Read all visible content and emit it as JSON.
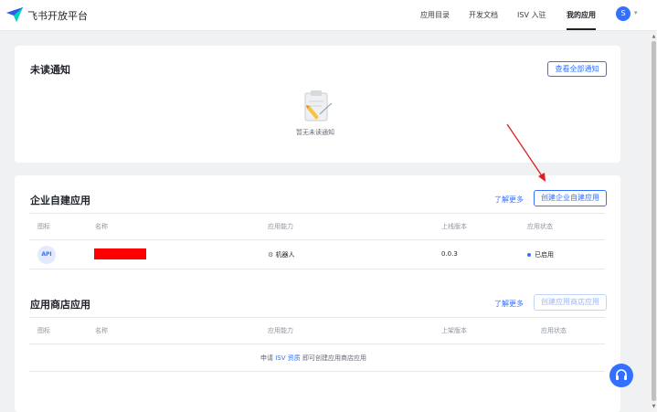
{
  "header": {
    "brand": "飞书开放平台",
    "nav": [
      "应用目录",
      "开发文档",
      "ISV 入驻",
      "我的应用"
    ],
    "active_nav": "我的应用",
    "avatar_letter": "S"
  },
  "notifications": {
    "title": "未读通知",
    "view_all_button": "查看全部通知",
    "empty_text": "暂无未读通知"
  },
  "enterprise_apps": {
    "title": "企业自建应用",
    "learn_more": "了解更多",
    "create_button": "创建企业自建应用",
    "columns": [
      "图标",
      "名称",
      "应用能力",
      "上线版本",
      "应用状态"
    ],
    "rows": [
      {
        "icon": "API",
        "capability": "机器人",
        "version": "0.0.3",
        "status": "已启用"
      }
    ]
  },
  "store_apps": {
    "title": "应用商店应用",
    "learn_more": "了解更多",
    "create_button": "创建应用商店应用",
    "columns": [
      "图标",
      "名称",
      "应用能力",
      "上架版本",
      "应用状态"
    ],
    "empty_prefix": "申请",
    "empty_link": "ISV 资质",
    "empty_suffix": "即可创建应用商店应用"
  },
  "colors": {
    "accent": "#3370ff",
    "annotation_arrow": "#e02020",
    "redaction": "#ff0000"
  }
}
